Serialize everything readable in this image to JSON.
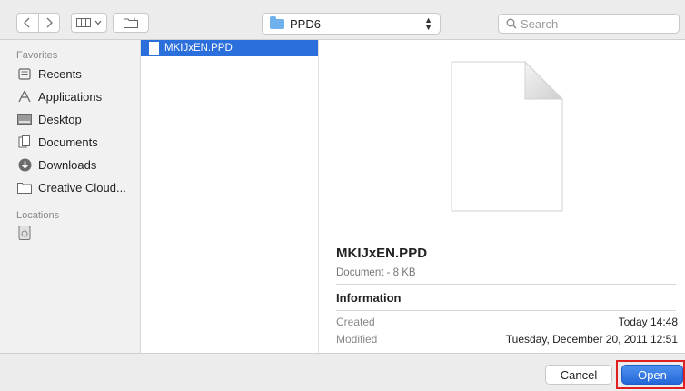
{
  "toolbar": {
    "back_icon": "chevron-left",
    "forward_icon": "chevron-right",
    "view_icon": "column-view",
    "new_folder_icon": "new-folder",
    "location": "PPD6",
    "search_placeholder": "Search"
  },
  "sidebar": {
    "favorites_title": "Favorites",
    "favorites": [
      {
        "label": "Recents",
        "icon": "recents-icon"
      },
      {
        "label": "Applications",
        "icon": "applications-icon"
      },
      {
        "label": "Desktop",
        "icon": "desktop-icon"
      },
      {
        "label": "Documents",
        "icon": "documents-icon"
      },
      {
        "label": "Downloads",
        "icon": "downloads-icon"
      },
      {
        "label": "Creative Cloud...",
        "icon": "folder-icon"
      }
    ],
    "locations_title": "Locations",
    "locations": [
      {
        "label": "",
        "icon": "disk-icon"
      }
    ]
  },
  "files": [
    {
      "name": "MKIJxEN.PPD",
      "selected": true
    }
  ],
  "preview": {
    "name": "MKIJxEN.PPD",
    "kind": "Document - 8 KB",
    "info_title": "Information",
    "created_label": "Created",
    "created_value": "Today 14:48",
    "modified_label": "Modified",
    "modified_value": "Tuesday, December 20, 2011 12:51"
  },
  "buttons": {
    "cancel": "Cancel",
    "open": "Open"
  },
  "colors": {
    "accent": "#2a6fdb",
    "highlight": "#e02020"
  }
}
